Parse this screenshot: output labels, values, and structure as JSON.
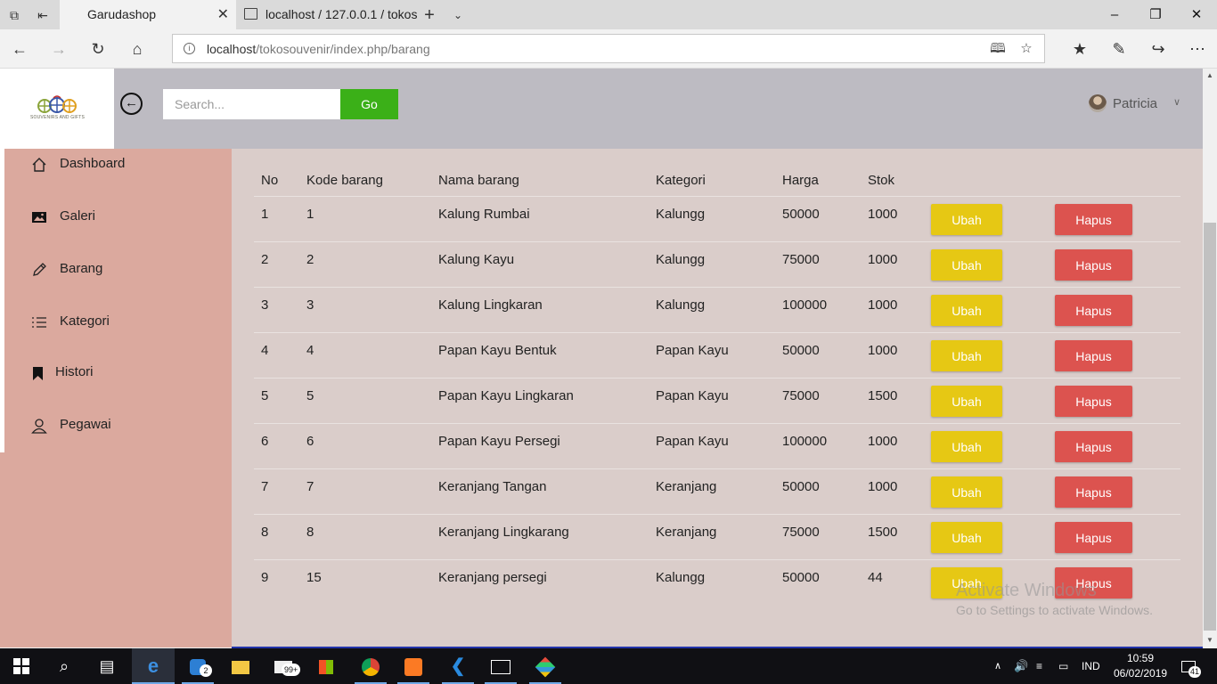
{
  "browser": {
    "tabs": [
      {
        "title": "Garudashop",
        "active": true
      },
      {
        "title": "localhost / 127.0.0.1 / tokos",
        "active": false
      }
    ],
    "url_host": "localhost",
    "url_path": "/tokosouvenir/index.php/barang"
  },
  "header": {
    "logo_caption": "SOUVENIRS AND GIFTS",
    "search_placeholder": "Search...",
    "go_label": "Go",
    "user_name": "Patricia"
  },
  "sidebar": {
    "items": [
      {
        "label": "Dashboard",
        "icon": "home-icon"
      },
      {
        "label": "Galeri",
        "icon": "image-icon"
      },
      {
        "label": "Barang",
        "icon": "pencil-icon"
      },
      {
        "label": "Kategori",
        "icon": "list-icon"
      },
      {
        "label": "Histori",
        "icon": "bookmark-icon"
      },
      {
        "label": "Pegawai",
        "icon": "user-icon"
      }
    ]
  },
  "table": {
    "headers": [
      "No",
      "Kode barang",
      "Nama barang",
      "Kategori",
      "Harga",
      "Stok"
    ],
    "edit_label": "Ubah",
    "delete_label": "Hapus",
    "rows": [
      {
        "no": "1",
        "kode": "1",
        "nama": "Kalung Rumbai",
        "kategori": "Kalungg",
        "harga": "50000",
        "stok": "1000"
      },
      {
        "no": "2",
        "kode": "2",
        "nama": "Kalung Kayu",
        "kategori": "Kalungg",
        "harga": "75000",
        "stok": "1000"
      },
      {
        "no": "3",
        "kode": "3",
        "nama": "Kalung Lingkaran",
        "kategori": "Kalungg",
        "harga": "100000",
        "stok": "1000"
      },
      {
        "no": "4",
        "kode": "4",
        "nama": "Papan Kayu Bentuk",
        "kategori": "Papan Kayu",
        "harga": "50000",
        "stok": "1000"
      },
      {
        "no": "5",
        "kode": "5",
        "nama": "Papan Kayu Lingkaran",
        "kategori": "Papan Kayu",
        "harga": "75000",
        "stok": "1500"
      },
      {
        "no": "6",
        "kode": "6",
        "nama": "Papan Kayu Persegi",
        "kategori": "Papan Kayu",
        "harga": "100000",
        "stok": "1000"
      },
      {
        "no": "7",
        "kode": "7",
        "nama": "Keranjang Tangan",
        "kategori": "Keranjang",
        "harga": "50000",
        "stok": "1000"
      },
      {
        "no": "8",
        "kode": "8",
        "nama": "Keranjang Lingkarang",
        "kategori": "Keranjang",
        "harga": "75000",
        "stok": "1500"
      },
      {
        "no": "9",
        "kode": "15",
        "nama": "Keranjang persegi",
        "kategori": "Kalungg",
        "harga": "50000",
        "stok": "44"
      }
    ]
  },
  "watermark": {
    "line1": "Activate Windows",
    "line2": "Go to Settings to activate Windows."
  },
  "taskbar": {
    "language": "IND",
    "time": "10:59",
    "date": "06/02/2019",
    "notification_count": "41",
    "badge_instagram": "2",
    "badge_mail": "99+"
  },
  "colors": {
    "sidebar_bg": "#dba99e",
    "content_bg": "#dacdca",
    "header_bg": "#bdbbc2",
    "go_green": "#3bb018",
    "ubah_yellow": "#e6c814",
    "hapus_red": "#dc534f"
  }
}
